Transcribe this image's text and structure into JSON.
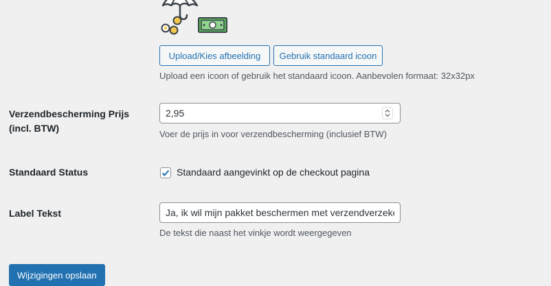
{
  "icon_upload": {
    "upload_button": "Upload/Kies afbeelding",
    "default_button": "Gebruik standaard icoon",
    "description": "Upload een icoon of gebruik het standaard icoon. Aanbevolen formaat: 32x32px"
  },
  "price": {
    "label_line1": "Verzendbescherming Prijs",
    "label_line2": "(incl. BTW)",
    "value": "2,95",
    "description": "Voer de prijs in voor verzendbescherming (inclusief BTW)"
  },
  "status": {
    "label": "Standaard Status",
    "checked": true,
    "checkbox_label": "Standaard aangevinkt op de checkout pagina"
  },
  "label_text": {
    "label": "Label Tekst",
    "value": "Ja, ik wil mijn pakket beschermen met verzendverzekering",
    "description": "De tekst die naast het vinkje wordt weergegeven"
  },
  "save_button": "Wijzigingen opslaan",
  "colors": {
    "primary": "#2271b1",
    "money_green": "#5cb85c",
    "coin_yellow": "#f2c94c"
  },
  "icons": {
    "shipping_protection": "umbrella-money-coins-icon",
    "checkmark": "checkmark-icon",
    "spinner_up": "chevron-up-icon",
    "spinner_down": "chevron-down-icon"
  }
}
